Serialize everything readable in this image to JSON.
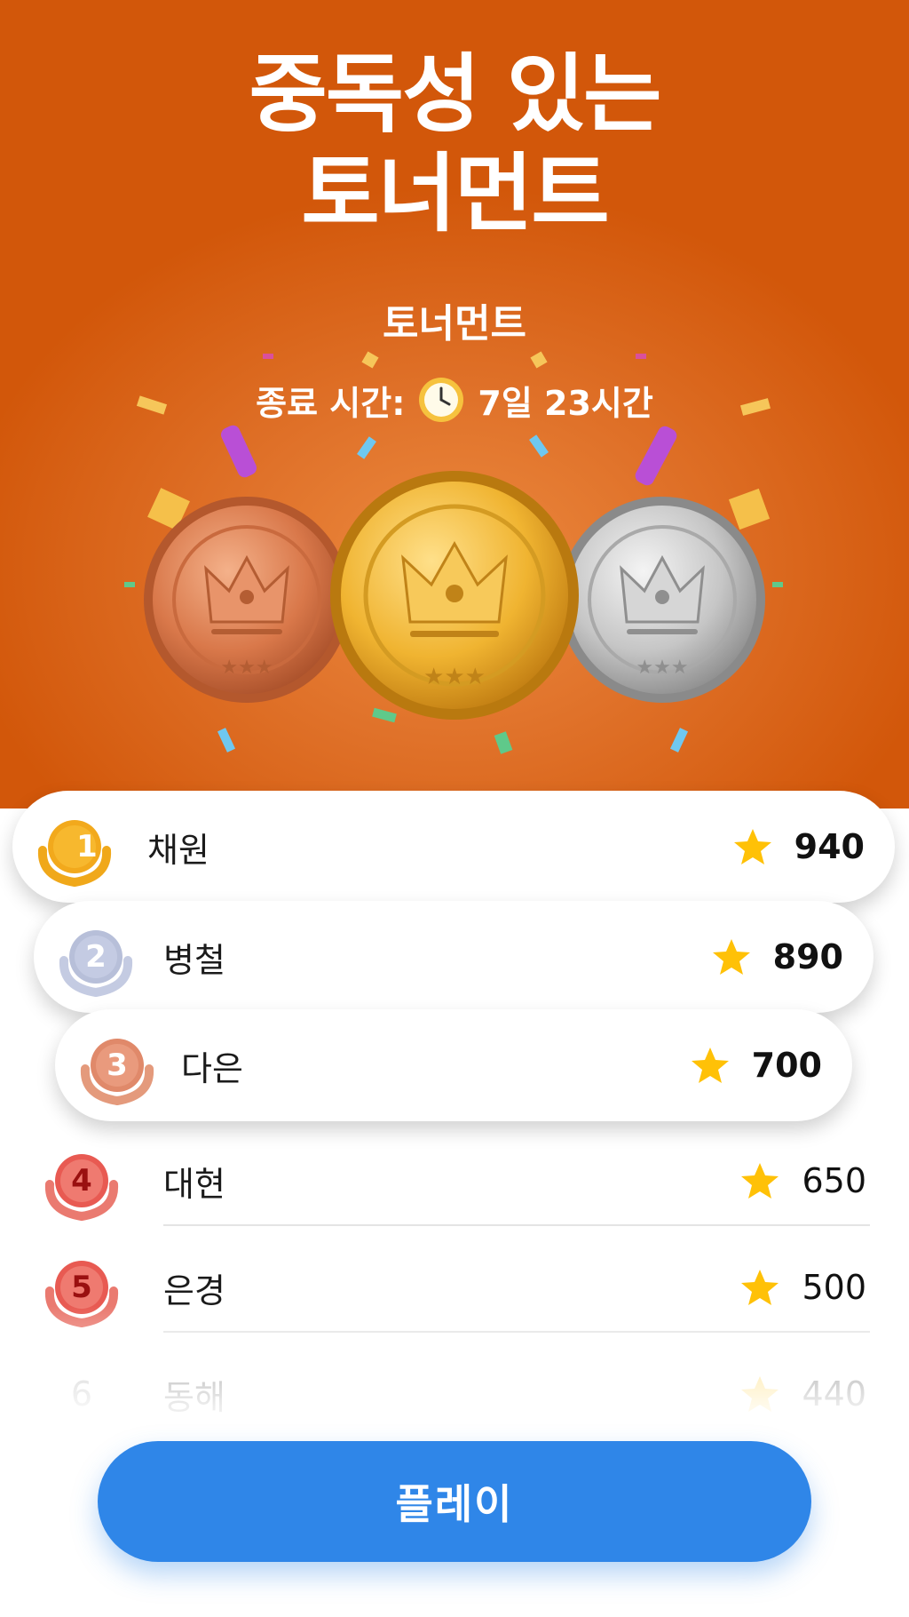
{
  "hero": {
    "title_line1": "중독성 있는",
    "title_line2": "토너먼트",
    "subtitle": "토너먼트",
    "end_label": "종료 시간:",
    "end_value": "7일 23시간"
  },
  "leaderboard": [
    {
      "rank": "1",
      "name": "채원",
      "score": "940"
    },
    {
      "rank": "2",
      "name": "병철",
      "score": "890"
    },
    {
      "rank": "3",
      "name": "다은",
      "score": "700"
    },
    {
      "rank": "4",
      "name": "대현",
      "score": "650"
    },
    {
      "rank": "5",
      "name": "은경",
      "score": "500"
    },
    {
      "rank": "6",
      "name": "동해",
      "score": "440"
    }
  ],
  "play_button": {
    "label": "플레이"
  },
  "colors": {
    "hero_bg": "#d2570a",
    "gold": "#f2a91c",
    "silver": "#b7bfd9",
    "bronze": "#e0896a",
    "red_badge": "#e85a52",
    "play_blue": "#2f86e8",
    "star": "#ffc107"
  },
  "icons": {
    "clock": "clock-icon",
    "star": "star-icon",
    "medal": "crown-medal-icon",
    "laurel": "laurel-badge-icon"
  }
}
